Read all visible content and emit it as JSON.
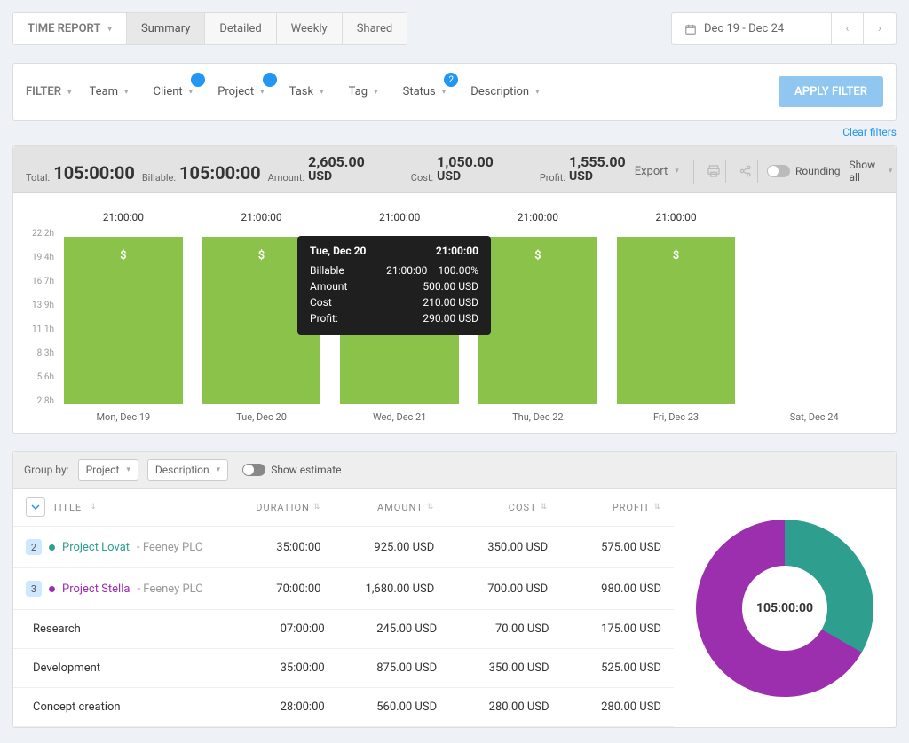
{
  "header": {
    "report_label": "TIME REPORT",
    "tabs": [
      "Summary",
      "Detailed",
      "Weekly",
      "Shared"
    ],
    "active_tab": "Summary",
    "date_range": "Dec 19 - Dec 24"
  },
  "filters": {
    "label": "FILTER",
    "items": [
      {
        "label": "Team",
        "badge": null
      },
      {
        "label": "Client",
        "badge": "…"
      },
      {
        "label": "Project",
        "badge": "…"
      },
      {
        "label": "Task",
        "badge": null
      },
      {
        "label": "Tag",
        "badge": null
      },
      {
        "label": "Status",
        "badge": "2"
      },
      {
        "label": "Description",
        "badge": null
      }
    ],
    "apply": "APPLY FILTER",
    "clear": "Clear filters"
  },
  "summary": {
    "total_label": "Total:",
    "total_value": "105:00:00",
    "billable_label": "Billable:",
    "billable_value": "105:00:00",
    "amount_label": "Amount:",
    "amount_value": "2,605.00",
    "cost_label": "Cost:",
    "cost_value": "1,050.00",
    "profit_label": "Profit:",
    "profit_value": "1,555.00",
    "currency": "USD",
    "export": "Export",
    "rounding": "Rounding",
    "showall": "Show all"
  },
  "chart_data": {
    "type": "bar",
    "ylabel_ticks": [
      "22.2h",
      "19.4h",
      "16.7h",
      "13.9h",
      "11.1h",
      "8.3h",
      "5.6h",
      "2.8h"
    ],
    "ylim": [
      0,
      22.2
    ],
    "categories": [
      "Mon, Dec 19",
      "Tue, Dec 20",
      "Wed, Dec 21",
      "Thu, Dec 22",
      "Fri, Dec 23",
      "Sat, Dec 24"
    ],
    "bar_labels": [
      "21:00:00",
      "21:00:00",
      "21:00:00",
      "21:00:00",
      "21:00:00",
      ""
    ],
    "bar_marker": "$",
    "values": [
      21,
      21,
      21,
      21,
      21,
      0
    ],
    "tooltip": {
      "title": "Tue, Dec 20",
      "total": "21:00:00",
      "rows": [
        {
          "k": "Billable",
          "v": "21:00:00",
          "pct": "100.00%"
        },
        {
          "k": "Amount",
          "v": "500.00 USD"
        },
        {
          "k": "Cost",
          "v": "210.00 USD"
        },
        {
          "k": "Profit:",
          "v": "290.00 USD"
        }
      ]
    }
  },
  "group": {
    "label": "Group by:",
    "select1": "Project",
    "select2": "Description",
    "show_estimate": "Show estimate"
  },
  "table": {
    "headers": {
      "title": "TITLE",
      "duration": "DURATION",
      "amount": "AMOUNT",
      "cost": "COST",
      "profit": "PROFIT"
    },
    "rows": [
      {
        "type": "project",
        "count": "2",
        "color": "#2e9e8f",
        "name": "Project Lovat",
        "client": "- Feeney PLC",
        "duration": "35:00:00",
        "amount": "925.00 USD",
        "cost": "350.00 USD",
        "profit": "575.00 USD"
      },
      {
        "type": "project",
        "count": "3",
        "color": "#9b2fae",
        "name": "Project Stella",
        "client": "- Feeney PLC",
        "duration": "70:00:00",
        "amount": "1,680.00 USD",
        "cost": "700.00 USD",
        "profit": "980.00 USD"
      },
      {
        "type": "sub",
        "name": "Research",
        "duration": "07:00:00",
        "amount": "245.00 USD",
        "cost": "70.00 USD",
        "profit": "175.00 USD"
      },
      {
        "type": "sub",
        "name": "Development",
        "duration": "35:00:00",
        "amount": "875.00 USD",
        "cost": "350.00 USD",
        "profit": "525.00 USD"
      },
      {
        "type": "sub",
        "name": "Concept creation",
        "duration": "28:00:00",
        "amount": "560.00 USD",
        "cost": "280.00 USD",
        "profit": "280.00 USD"
      }
    ]
  },
  "donut": {
    "center": "105:00:00",
    "segments": [
      {
        "color": "#2e9e8f",
        "fraction": 0.333
      },
      {
        "color": "#9b2fae",
        "fraction": 0.667
      }
    ]
  }
}
